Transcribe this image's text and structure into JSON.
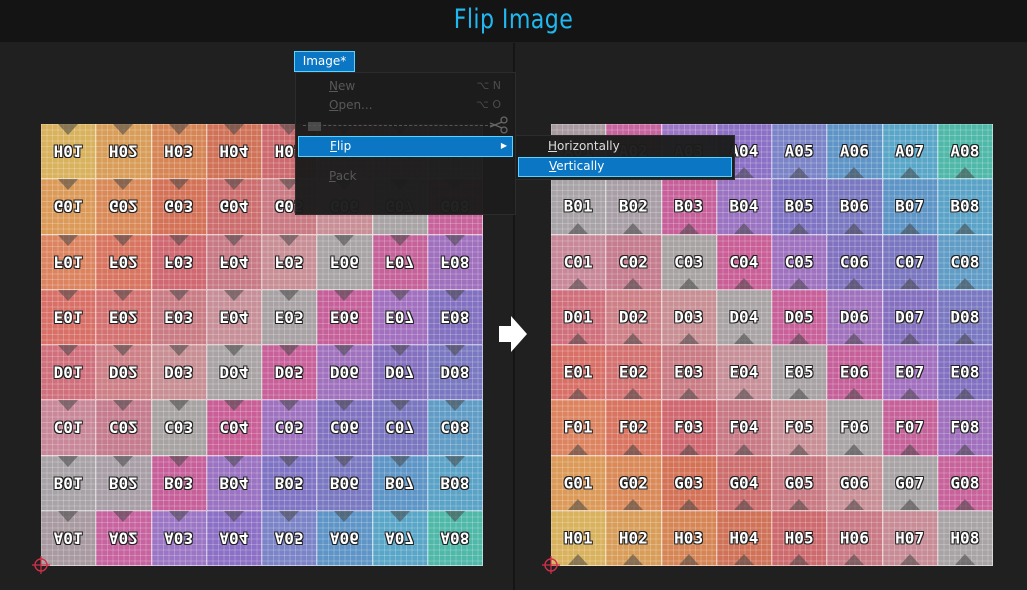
{
  "header": {
    "title": "Flip Image"
  },
  "colors": {
    "accent": "#20b8f0",
    "menu_highlight": "#0a76c4",
    "menu_border": "#5ad4ff"
  },
  "menu": {
    "tab_label": "Image*",
    "items": [
      {
        "label": "New",
        "shortcut": "⌥ N",
        "enabled": false
      },
      {
        "label": "Open...",
        "shortcut": "⌥ O",
        "enabled": false
      },
      {
        "label": "Flip",
        "has_submenu": true,
        "selected": true
      },
      {
        "label": "Pack",
        "enabled": false
      }
    ],
    "submenu": [
      {
        "label": "Horizontally"
      },
      {
        "label": "Vertically",
        "selected": true
      }
    ]
  },
  "grid": {
    "rows": [
      "A",
      "B",
      "C",
      "D",
      "E",
      "F",
      "G",
      "H"
    ],
    "cols": [
      "01",
      "02",
      "03",
      "04",
      "05",
      "06",
      "07",
      "08"
    ],
    "colors": [
      [
        "#a89aa0",
        "#c764a0",
        "#9b76c4",
        "#8b70c6",
        "#7c84c8",
        "#5f94c6",
        "#5aa6c8",
        "#4fb8a8"
      ],
      [
        "#a8a3a6",
        "#a89fa6",
        "#c7609a",
        "#9a73c2",
        "#7f74c4",
        "#7a78c0",
        "#5d95c6",
        "#5aa2c6"
      ],
      [
        "#c8889a",
        "#c47c8e",
        "#a8a3a3",
        "#c95f96",
        "#9f72c0",
        "#8172c0",
        "#7a76bf",
        "#609cc6"
      ],
      [
        "#d0707c",
        "#cd8086",
        "#c88f94",
        "#a9a3a4",
        "#c8609a",
        "#a072be",
        "#8570c0",
        "#7a78c0"
      ],
      [
        "#d87068",
        "#d47272",
        "#c97c84",
        "#c79099",
        "#a8a2a4",
        "#c5609a",
        "#a270bf",
        "#8270c0"
      ],
      [
        "#dc8460",
        "#d87460",
        "#cf6870",
        "#c77a85",
        "#c98f97",
        "#a8a3a4",
        "#c6629a",
        "#a070be"
      ],
      [
        "#dc9a58",
        "#da8a58",
        "#d47258",
        "#cc6e6e",
        "#c97a82",
        "#c88f96",
        "#a8a3a4",
        "#c7629a"
      ],
      [
        "#d9b25e",
        "#d99d5a",
        "#d68656",
        "#d07258",
        "#cd6a6e",
        "#c97a84",
        "#c88c96",
        "#a8a3a4"
      ]
    ]
  }
}
